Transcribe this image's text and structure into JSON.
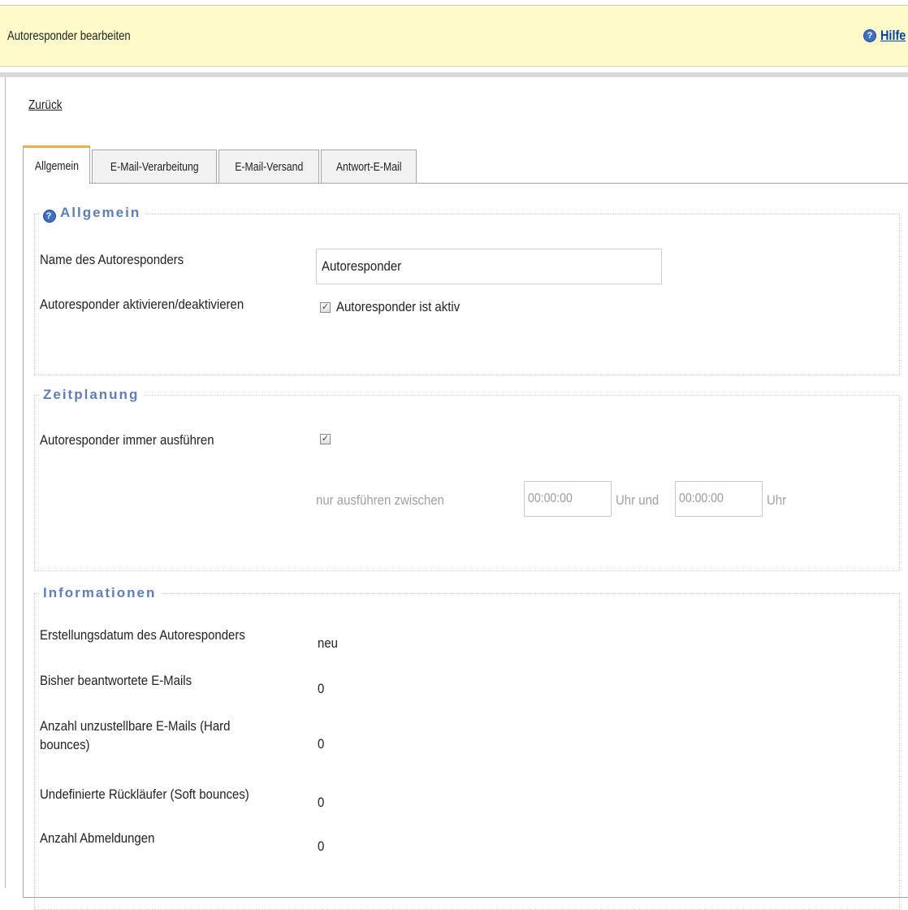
{
  "header": {
    "title": "Autoresponder bearbeiten",
    "help_label": "Hilfe"
  },
  "back_link": "Zurück",
  "tabs": [
    {
      "label": "Allgemein",
      "active": true
    },
    {
      "label": "E-Mail-Verarbeitung",
      "active": false
    },
    {
      "label": "E-Mail-Versand",
      "active": false
    },
    {
      "label": "Antwort-E-Mail",
      "active": false
    }
  ],
  "section_general": {
    "legend": "Allgemein",
    "name_label": "Name des Autoresponders",
    "name_value": "Autoresponder",
    "activate_label": "Autoresponder aktivieren/deaktivieren",
    "active_checkbox_label": "Autoresponder ist aktiv",
    "active_checked": true
  },
  "section_schedule": {
    "legend": "Zeitplanung",
    "always_label": "Autoresponder immer ausführen",
    "always_checked": true,
    "only_between_label": "nur ausführen zwischen",
    "time_from": "00:00:00",
    "clock_and_label": "Uhr und",
    "time_to": "00:00:00",
    "clock_label": "Uhr"
  },
  "section_info": {
    "legend": "Informationen",
    "rows": [
      {
        "label": "Erstellungsdatum des Autoresponders",
        "value": "neu"
      },
      {
        "label": "Bisher beantwortete E-Mails",
        "value": "0"
      },
      {
        "label": "Anzahl unzustellbare E-Mails (Hard\nbounces)",
        "value": "0"
      },
      {
        "label": "Undefinierte Rückläufer (Soft bounces)",
        "value": "0"
      },
      {
        "label": "Anzahl Abmeldungen",
        "value": "0"
      }
    ]
  },
  "colors": {
    "header_bg": "#fdfbc9",
    "legend_text": "#5b7fb6",
    "link": "#0045a8",
    "tab_active_accent": "#e7b24a"
  },
  "icons": {
    "help": "question-circle-icon",
    "checkbox": "checkmark-icon"
  }
}
